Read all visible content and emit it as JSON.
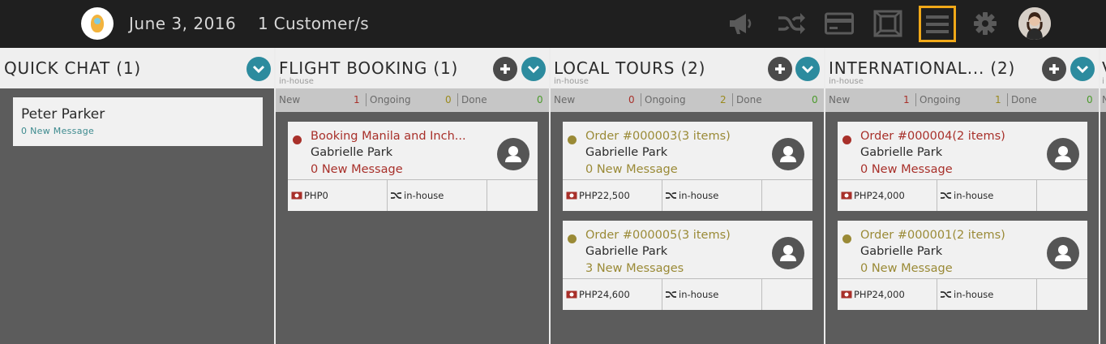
{
  "topbar": {
    "date": "June 3, 2016",
    "customers": "1 Customer/s",
    "icons": [
      "megaphone-icon",
      "shuffle-icon",
      "credit-card-icon",
      "expand-icon",
      "menu-icon",
      "gear-icon"
    ],
    "active_icon": "menu-icon",
    "colors": {
      "background": "#1f1f1f",
      "icon": "#5a5a5a",
      "active_border": "#f0a818"
    }
  },
  "columns": [
    {
      "title": "QUICK CHAT (1)",
      "chats": [
        {
          "name": "Peter Parker",
          "message": "0 New Message"
        }
      ]
    },
    {
      "title": "FLIGHT BOOKING (1)",
      "subtitle": "in-house",
      "stats": {
        "new_label": "New",
        "new": "1",
        "ongoing_label": "Ongoing",
        "ongoing": "0",
        "done_label": "Done",
        "done": "0"
      },
      "cards": [
        {
          "title": "Booking Manila and Inch...",
          "customer": "Gabrielle Park",
          "message": "0 New Message",
          "amount": "PHP0",
          "source": "in-house",
          "status": "red"
        }
      ]
    },
    {
      "title": "LOCAL TOURS (2)",
      "subtitle": "in-house",
      "stats": {
        "new_label": "New",
        "new": "0",
        "ongoing_label": "Ongoing",
        "ongoing": "2",
        "done_label": "Done",
        "done": "0"
      },
      "cards": [
        {
          "title": "Order #000003(3 items)",
          "customer": "Gabrielle Park",
          "message": "0 New Message",
          "amount": "PHP22,500",
          "source": "in-house",
          "status": "olive"
        },
        {
          "title": "Order #000005(3 items)",
          "customer": "Gabrielle Park",
          "message": "3 New Messages",
          "amount": "PHP24,600",
          "source": "in-house",
          "status": "olive"
        }
      ]
    },
    {
      "title": "INTERNATIONAL... (2)",
      "subtitle": "in-house",
      "stats": {
        "new_label": "New",
        "new": "1",
        "ongoing_label": "Ongoing",
        "ongoing": "1",
        "done_label": "Done",
        "done": "0"
      },
      "cards": [
        {
          "title": "Order #000004(2 items)",
          "customer": "Gabrielle Park",
          "message": "0 New Message",
          "amount": "PHP24,000",
          "source": "in-house",
          "status": "red"
        },
        {
          "title": "Order #000001(2 items)",
          "customer": "Gabrielle Park",
          "message": "0 New Message",
          "amount": "PHP24,000",
          "source": "in-house",
          "status": "olive"
        }
      ]
    },
    {
      "title": "V",
      "subtitle": "i",
      "stats": {
        "new_label": "N"
      }
    }
  ],
  "colors": {
    "status_red": "#a8302a",
    "status_olive": "#9a8a36",
    "chevron_button": "#2c8b9e",
    "done_green": "#4a9a2a"
  }
}
